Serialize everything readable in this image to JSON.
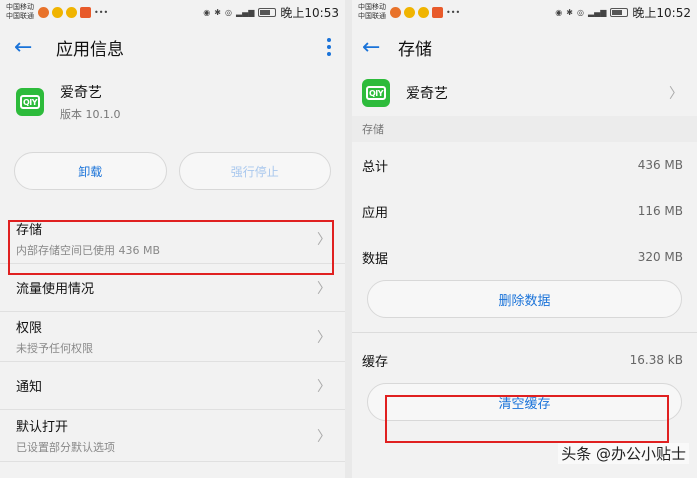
{
  "left": {
    "status": {
      "carrier1": "中国移动",
      "carrier2": "中国联通",
      "time": "晚上10:53"
    },
    "appbar": {
      "title": "应用信息"
    },
    "app": {
      "name": "爱奇艺",
      "version": "版本 10.1.0",
      "logo_text": "QIY"
    },
    "buttons": {
      "uninstall": "卸载",
      "force_stop": "强行停止"
    },
    "items": [
      {
        "title": "存储",
        "subtitle": "内部存储空间已使用 436 MB"
      },
      {
        "title": "流量使用情况",
        "subtitle": ""
      },
      {
        "title": "权限",
        "subtitle": "未授予任何权限"
      },
      {
        "title": "通知",
        "subtitle": ""
      },
      {
        "title": "默认打开",
        "subtitle": "已设置部分默认选项"
      }
    ]
  },
  "right": {
    "status": {
      "carrier1": "中国移动",
      "carrier2": "中国联通",
      "time": "晚上10:52"
    },
    "appbar": {
      "title": "存储"
    },
    "app": {
      "name": "爱奇艺",
      "logo_text": "QIY"
    },
    "section": "存储",
    "rows": [
      {
        "label": "总计",
        "value": "436 MB"
      },
      {
        "label": "应用",
        "value": "116 MB"
      },
      {
        "label": "数据",
        "value": "320 MB"
      }
    ],
    "delete_data": "删除数据",
    "cache": {
      "label": "缓存",
      "value": "16.38 kB"
    },
    "clear_cache": "清空缓存"
  },
  "watermark": "头条 @办公小贴士",
  "colors": {
    "accent": "#1a73d9",
    "highlight": "#e02020",
    "app_green": "#2dbb3b"
  }
}
